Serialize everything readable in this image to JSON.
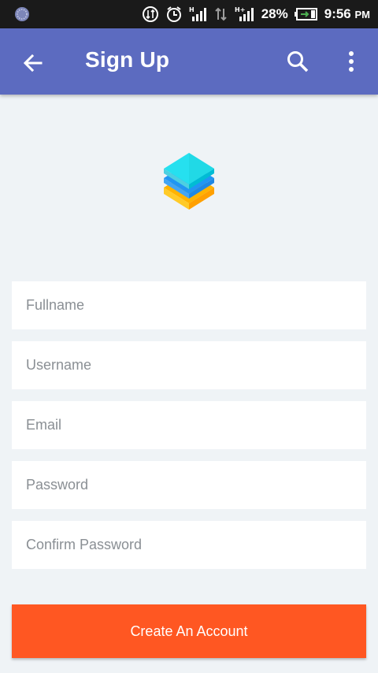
{
  "status_bar": {
    "battery": "28%",
    "time": "9:56",
    "ampm": "PM",
    "icons": [
      "app-notification-icon",
      "data-transfer-icon",
      "alarm-icon",
      "signal-h-icon",
      "data-arrows-icon",
      "signal-hplus-icon",
      "battery-charging-icon"
    ]
  },
  "app_bar": {
    "title": "Sign Up",
    "background": "#5c6bc0",
    "icons": [
      "back-arrow-icon",
      "search-icon",
      "more-vert-icon"
    ]
  },
  "logo": {
    "icon": "stacked-layers-logo",
    "colors": [
      "#26e0ef",
      "#2196f3",
      "#ffb300"
    ]
  },
  "form": {
    "fullname_placeholder": "Fullname",
    "username_placeholder": "Username",
    "email_placeholder": "Email",
    "password_placeholder": "Password",
    "confirm_password_placeholder": "Confirm Password"
  },
  "actions": {
    "create_account_label": "Create An Account",
    "button_color": "#ff5722"
  }
}
